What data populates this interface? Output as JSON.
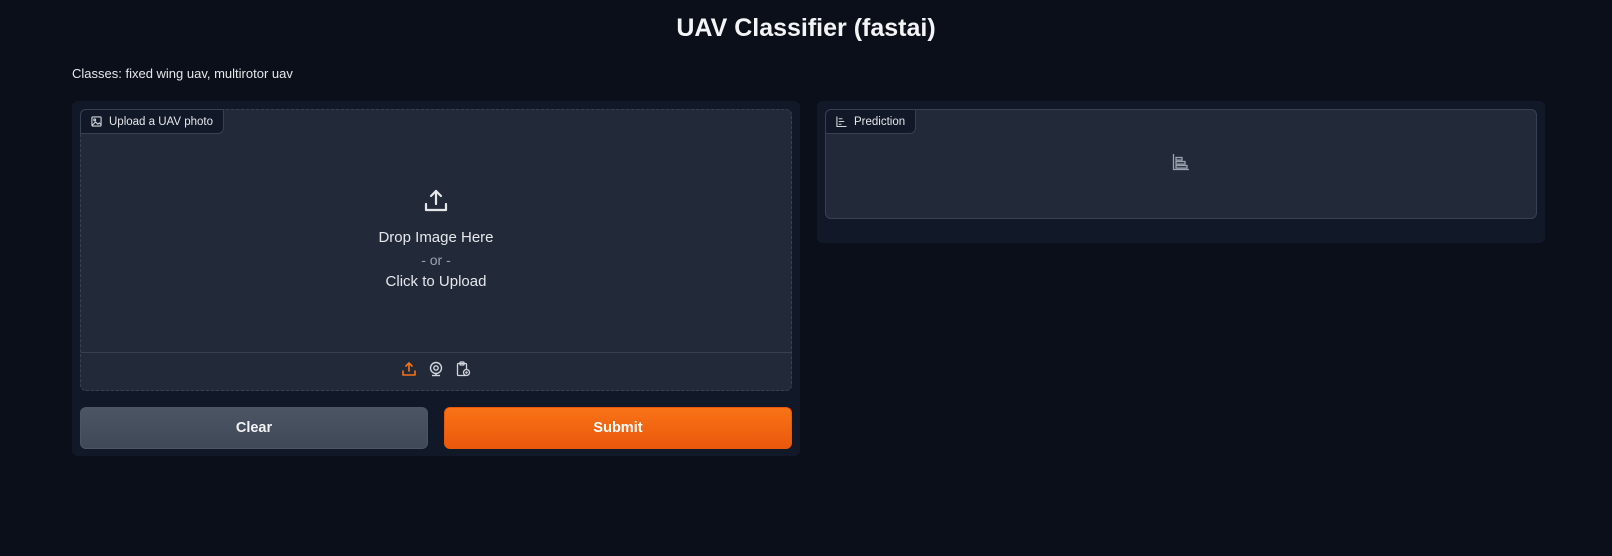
{
  "app": {
    "title": "UAV Classifier (fastai)",
    "description": "Classes: fixed wing uav, multirotor uav"
  },
  "input": {
    "label": "Upload a UAV photo",
    "label_icon": "image-icon",
    "drop_title": "Drop Image Here",
    "drop_or": "- or -",
    "drop_click": "Click to Upload",
    "sources": [
      {
        "name": "upload",
        "icon": "upload-icon",
        "active": true
      },
      {
        "name": "webcam",
        "icon": "webcam-icon",
        "active": false
      },
      {
        "name": "clipboard",
        "icon": "clipboard-icon",
        "active": false
      }
    ]
  },
  "output": {
    "label": "Prediction",
    "label_icon": "bar-chart-icon",
    "empty_icon": "bar-chart-icon"
  },
  "buttons": {
    "clear_label": "Clear",
    "submit_label": "Submit"
  },
  "colors": {
    "background": "#0b0f19",
    "panel": "#111827",
    "block": "#222a3a",
    "accent": "#f97316",
    "secondary_button": "#4b5563"
  }
}
